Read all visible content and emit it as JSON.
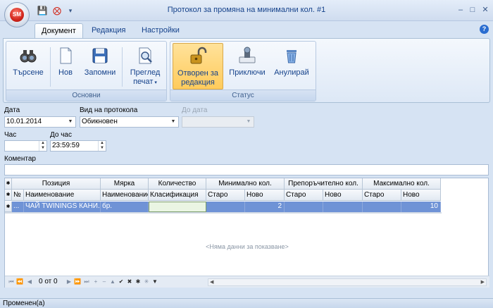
{
  "window": {
    "title": "Протокол за промяна на минимални кол. #1",
    "app_badge": "SM"
  },
  "tabs": [
    {
      "label": "Документ",
      "active": true
    },
    {
      "label": "Редакция",
      "active": false
    },
    {
      "label": "Настройки",
      "active": false
    }
  ],
  "ribbon": {
    "main_group": {
      "label": "Основни",
      "search": "Търсене",
      "new": "Нов",
      "save": "Запомни",
      "preview_l1": "Преглед",
      "preview_l2": "печат"
    },
    "status_group": {
      "label": "Статус",
      "open_l1": "Отворен за",
      "open_l2": "редакция",
      "close": "Приключи",
      "cancel": "Анулирай"
    }
  },
  "form": {
    "date_label": "Дата",
    "date_value": "10.01.2014",
    "type_label": "Вид на протокола",
    "type_value": "Обикновен",
    "to_date_label": "До дата",
    "to_date_value": "",
    "hour_label": "Час",
    "hour_value": "",
    "to_hour_label": "До час",
    "to_hour_value": "23:59:59",
    "comment_label": "Коментар",
    "comment_value": ""
  },
  "grid": {
    "bands": {
      "position": "Позиция",
      "unit": "Мярка",
      "quantity": "Количество",
      "min_qty": "Минимално кол.",
      "recommended_qty": "Препоръчително кол.",
      "max_qty": "Максимално кол."
    },
    "columns": {
      "no": "№",
      "name": "Наименование",
      "unit_name": "Наименование",
      "classification": "Класификация",
      "min_old": "Старо",
      "min_new": "Ново",
      "rec_old": "Старо",
      "rec_new": "Ново",
      "max_old": "Старо",
      "max_new": "Ново"
    },
    "rows": [
      {
        "no": "...",
        "name": "ЧАЙ TWININGS КАНИ...",
        "unit": "бр.",
        "classification": "",
        "min_old": "",
        "min_new": "2",
        "rec_old": "",
        "rec_new": "",
        "max_old": "",
        "max_new": "10"
      }
    ],
    "empty_text": "<Няма данни за показване>",
    "nav_text": "0 от 0"
  },
  "status_text": "Променен(а)",
  "colors": {
    "selected_row": "#6f93d6",
    "title_text": "#15428b",
    "active_ribbon_button": "#ffcb5c"
  }
}
